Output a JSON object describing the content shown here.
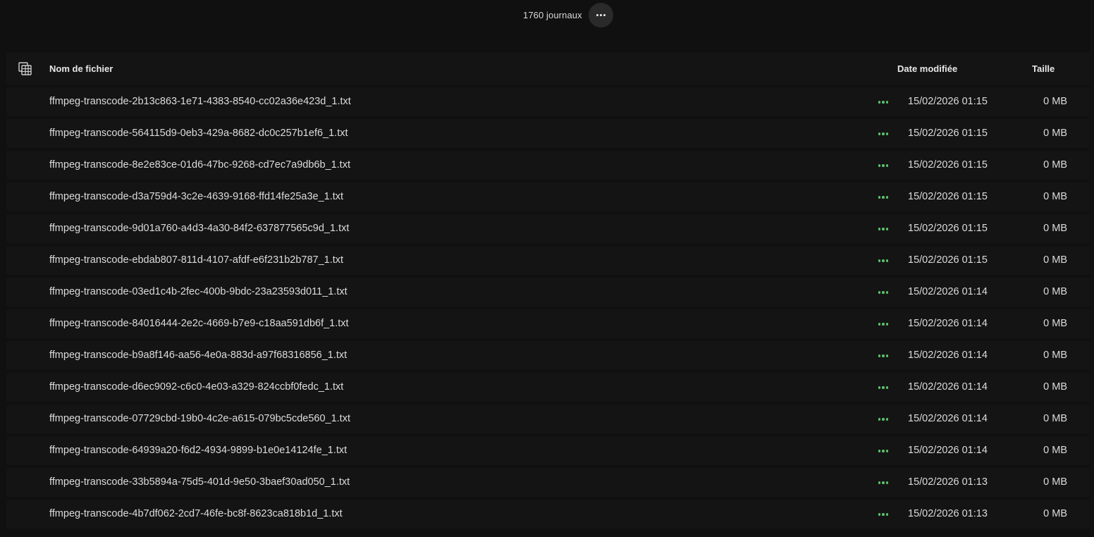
{
  "header": {
    "count_label": "1760 journaux",
    "more_icon": "ellipsis-horizontal-icon"
  },
  "table": {
    "select_icon": "table-columns-icon",
    "columns": {
      "name": "Nom de fichier",
      "date": "Date modifiée",
      "size": "Taille"
    },
    "row_menu_icon": "ellipsis-horizontal-icon",
    "row_menu_color": "#5cc069",
    "rows": [
      {
        "name": "ffmpeg-transcode-2b13c863-1e71-4383-8540-cc02a36e423d_1.txt",
        "date": "15/02/2026 01:15",
        "size": "0 MB"
      },
      {
        "name": "ffmpeg-transcode-564115d9-0eb3-429a-8682-dc0c257b1ef6_1.txt",
        "date": "15/02/2026 01:15",
        "size": "0 MB"
      },
      {
        "name": "ffmpeg-transcode-8e2e83ce-01d6-47bc-9268-cd7ec7a9db6b_1.txt",
        "date": "15/02/2026 01:15",
        "size": "0 MB"
      },
      {
        "name": "ffmpeg-transcode-d3a759d4-3c2e-4639-9168-ffd14fe25a3e_1.txt",
        "date": "15/02/2026 01:15",
        "size": "0 MB"
      },
      {
        "name": "ffmpeg-transcode-9d01a760-a4d3-4a30-84f2-637877565c9d_1.txt",
        "date": "15/02/2026 01:15",
        "size": "0 MB"
      },
      {
        "name": "ffmpeg-transcode-ebdab807-811d-4107-afdf-e6f231b2b787_1.txt",
        "date": "15/02/2026 01:15",
        "size": "0 MB"
      },
      {
        "name": "ffmpeg-transcode-03ed1c4b-2fec-400b-9bdc-23a23593d011_1.txt",
        "date": "15/02/2026 01:14",
        "size": "0 MB"
      },
      {
        "name": "ffmpeg-transcode-84016444-2e2c-4669-b7e9-c18aa591db6f_1.txt",
        "date": "15/02/2026 01:14",
        "size": "0 MB"
      },
      {
        "name": "ffmpeg-transcode-b9a8f146-aa56-4e0a-883d-a97f68316856_1.txt",
        "date": "15/02/2026 01:14",
        "size": "0 MB"
      },
      {
        "name": "ffmpeg-transcode-d6ec9092-c6c0-4e03-a329-824ccbf0fedc_1.txt",
        "date": "15/02/2026 01:14",
        "size": "0 MB"
      },
      {
        "name": "ffmpeg-transcode-07729cbd-19b0-4c2e-a615-079bc5cde560_1.txt",
        "date": "15/02/2026 01:14",
        "size": "0 MB"
      },
      {
        "name": "ffmpeg-transcode-64939a20-f6d2-4934-9899-b1e0e14124fe_1.txt",
        "date": "15/02/2026 01:14",
        "size": "0 MB"
      },
      {
        "name": "ffmpeg-transcode-33b5894a-75d5-401d-9e50-3baef30ad050_1.txt",
        "date": "15/02/2026 01:13",
        "size": "0 MB"
      },
      {
        "name": "ffmpeg-transcode-4b7df062-2cd7-46fe-bc8f-8623ca818b1d_1.txt",
        "date": "15/02/2026 01:13",
        "size": "0 MB"
      }
    ]
  }
}
